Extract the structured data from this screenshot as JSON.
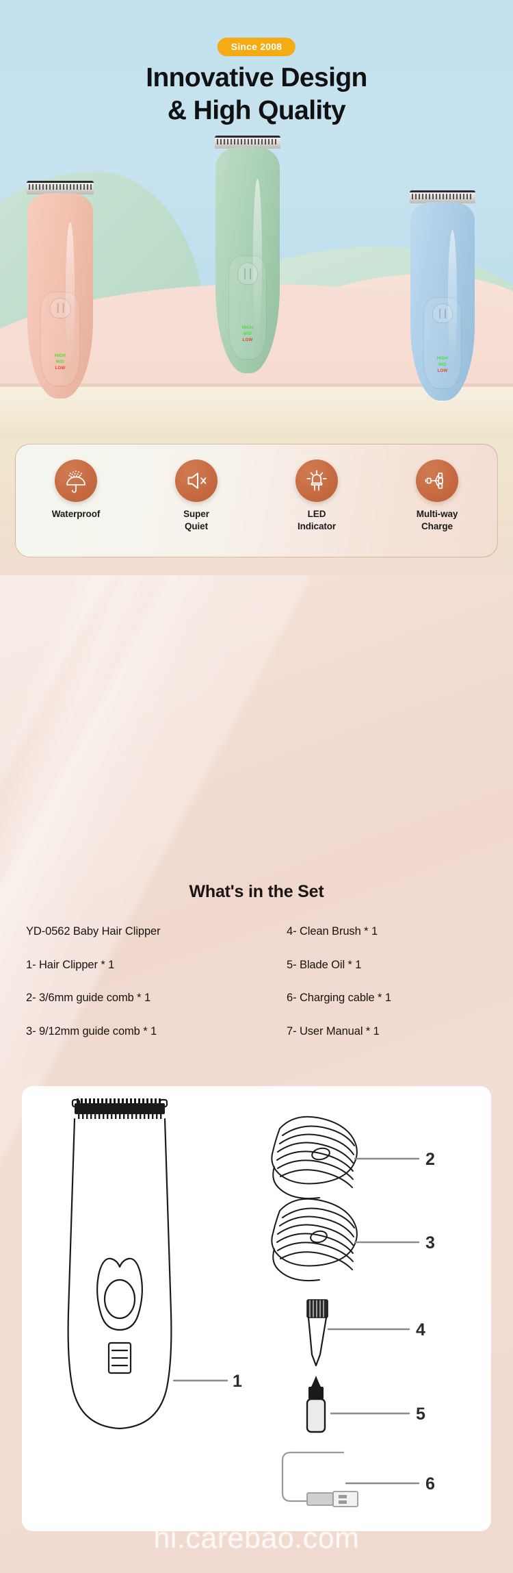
{
  "hero": {
    "badge": "Since 2008",
    "title_line1": "Innovative Design",
    "title_line2": "& High Quality",
    "background_color": "#c5e3ee",
    "badge_color": "#f5ab14",
    "products": [
      {
        "name": "pink-clipper",
        "color": "#f2c0ae",
        "led_high": "HIGH",
        "led_mid": "MID",
        "led_low": "LOW"
      },
      {
        "name": "green-clipper",
        "color": "#a9d0b4",
        "led_high": "HIGH",
        "led_mid": "MID",
        "led_low": "LOW"
      },
      {
        "name": "blue-clipper",
        "color": "#a9cce6",
        "led_high": "HIGH",
        "led_mid": "MID",
        "led_low": "LOW"
      }
    ]
  },
  "features": {
    "icon_color": "#c76b42",
    "items": [
      {
        "icon": "umbrella-rain-icon",
        "label_line1": "Waterproof",
        "label_line2": ""
      },
      {
        "icon": "speaker-muted-icon",
        "label_line1": "Super",
        "label_line2": "Quiet"
      },
      {
        "icon": "led-bulb-icon",
        "label_line1": "LED",
        "label_line2": "Indicator"
      },
      {
        "icon": "multi-plug-icon",
        "label_line1": "Multi-way",
        "label_line2": "Charge"
      }
    ]
  },
  "set": {
    "title": "What's in the Set",
    "left_items": [
      "YD-0562 Baby Hair Clipper",
      "1- Hair Clipper * 1",
      "2- 3/6mm guide comb * 1",
      "3- 9/12mm guide comb * 1"
    ],
    "right_items": [
      "4- Clean Brush * 1",
      "5- Blade Oil * 1",
      "6- Charging cable * 1",
      "7- User Manual * 1"
    ]
  },
  "diagram": {
    "callouts": [
      {
        "number": "1",
        "part": "hair-clipper"
      },
      {
        "number": "2",
        "part": "guide-comb-3-6mm"
      },
      {
        "number": "3",
        "part": "guide-comb-9-12mm"
      },
      {
        "number": "4",
        "part": "clean-brush"
      },
      {
        "number": "5",
        "part": "blade-oil"
      },
      {
        "number": "6",
        "part": "charging-cable"
      }
    ]
  },
  "watermark": {
    "text": "hi.carebao.com"
  }
}
